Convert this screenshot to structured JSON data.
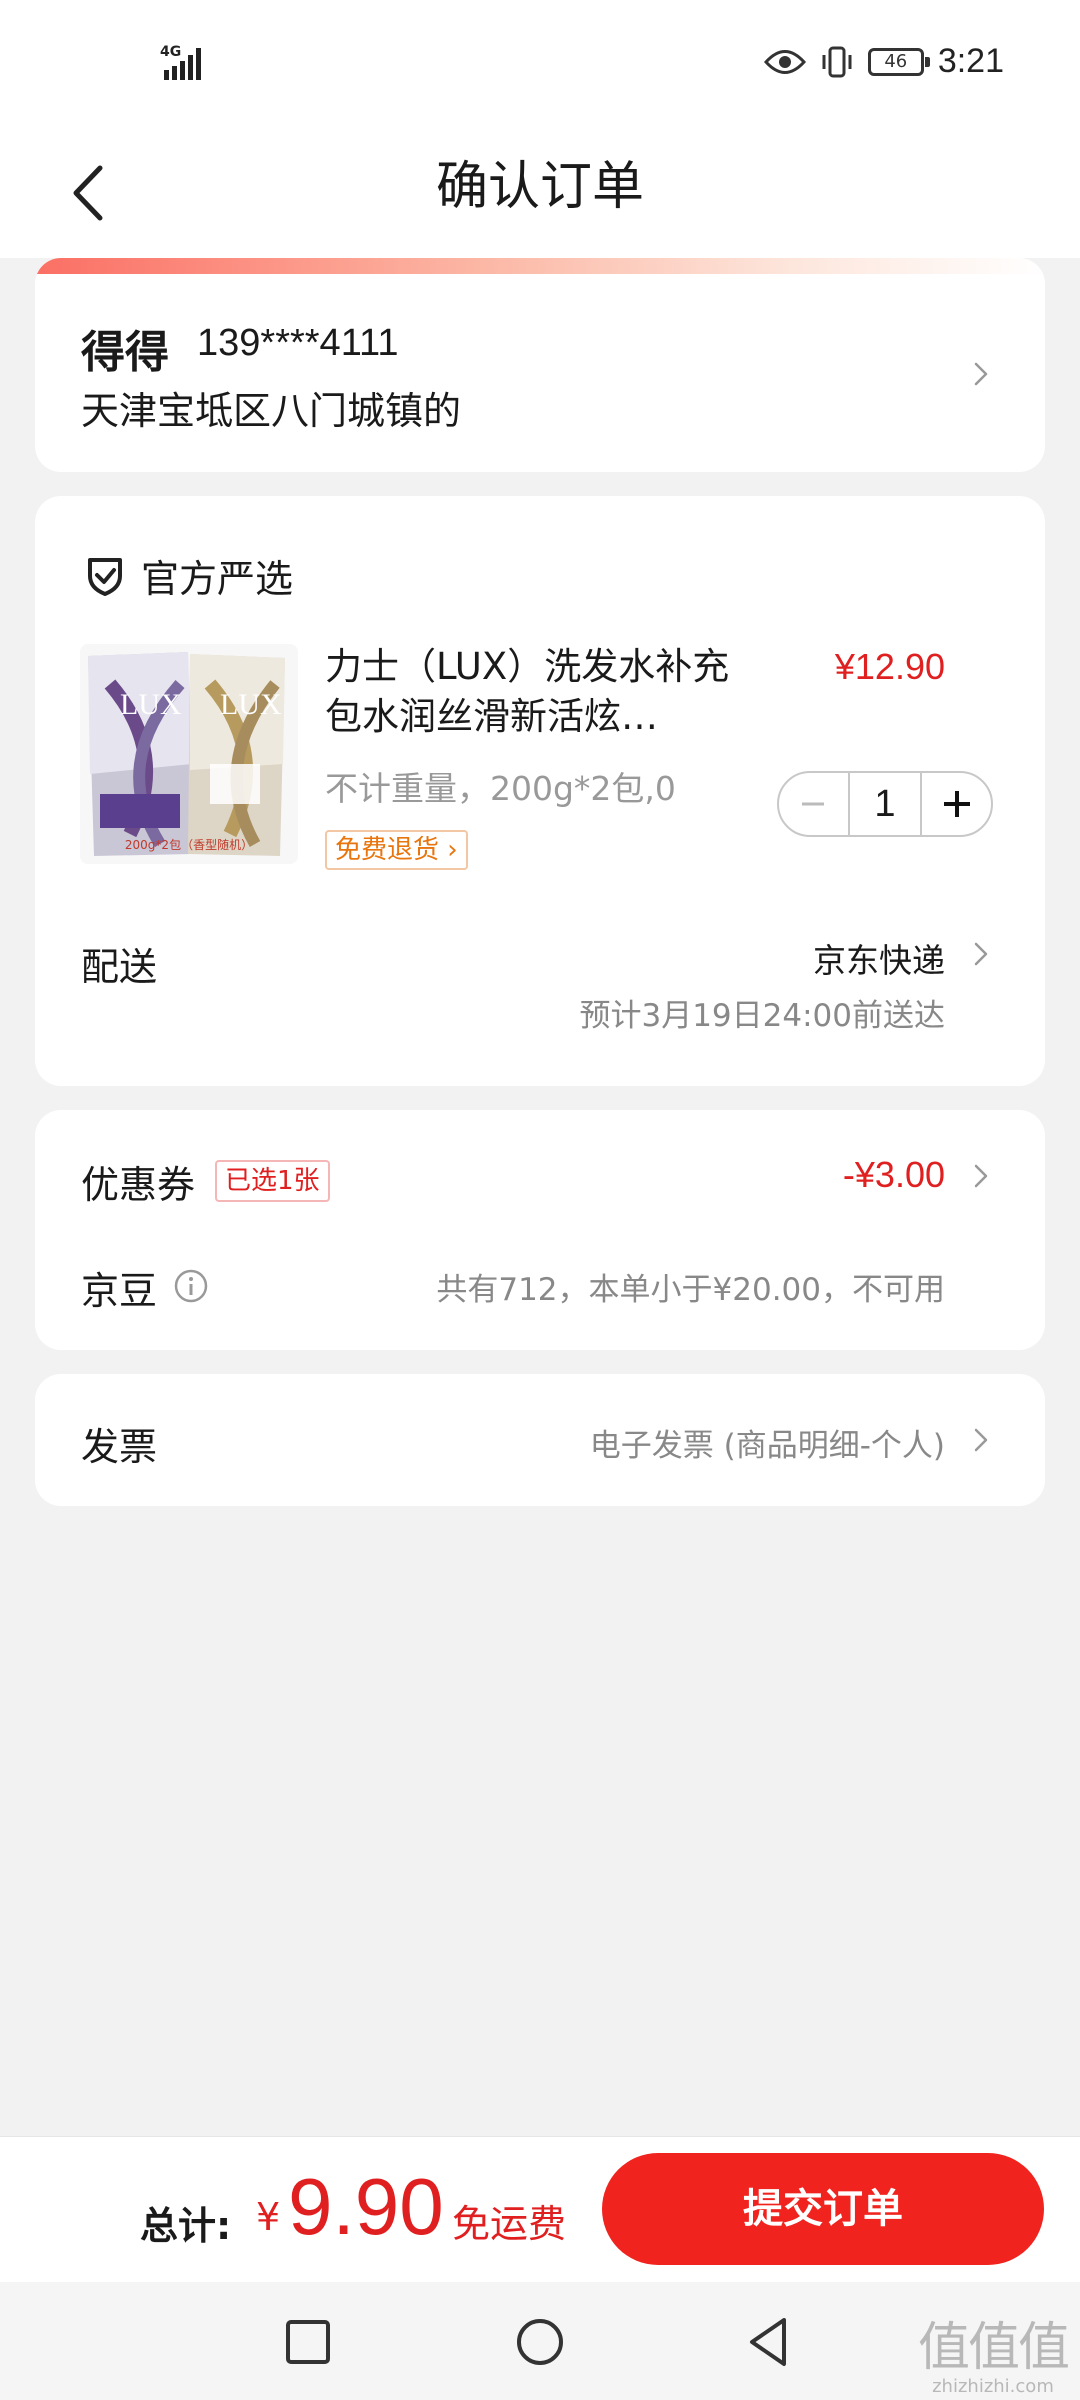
{
  "status_bar": {
    "network": "4G",
    "battery": "46",
    "time": "3:21",
    "icons": [
      "signal-icon",
      "eye-icon",
      "vibrate-icon",
      "battery-icon"
    ]
  },
  "header": {
    "title": "确认订单",
    "back_icon": "chevron-left-icon"
  },
  "address": {
    "name": "得得",
    "phone": "139****4111",
    "line": "天津宝坻区八门城镇的"
  },
  "goods": {
    "badge_label": "官方严选",
    "badge_icon": "shield-check-icon",
    "product": {
      "title": "力士（LUX）洗发水补充包水润丝滑新活炫…",
      "price": "¥12.90",
      "spec": "不计重量，200g*2包,0",
      "refund_tag": "免费退货 ›",
      "image_brand": "LUX",
      "image_caption": "200g*2包（香型随机）",
      "quantity": "1"
    },
    "shipping": {
      "label": "配送",
      "carrier": "京东快递",
      "eta": "预计3月19日24:00前送达"
    }
  },
  "promo": {
    "coupon_label": "优惠券",
    "coupon_tag": "已选1张",
    "coupon_amount": "-¥3.00",
    "bean_label": "京豆",
    "bean_note": "共有712，本单小于¥20.00，不可用"
  },
  "invoice": {
    "label": "发票",
    "value": "电子发票 (商品明细-个人)"
  },
  "footer": {
    "total_label": "总计:",
    "currency": "¥",
    "total_amount": "9.90",
    "free_shipping": "免运费",
    "submit_label": "提交订单"
  },
  "watermark": {
    "logo": "值值值",
    "url": "zhizhizhi.com"
  },
  "colors": {
    "accent_red": "#f0231e",
    "price_red": "#e02020",
    "background": "#f2f2f2"
  }
}
